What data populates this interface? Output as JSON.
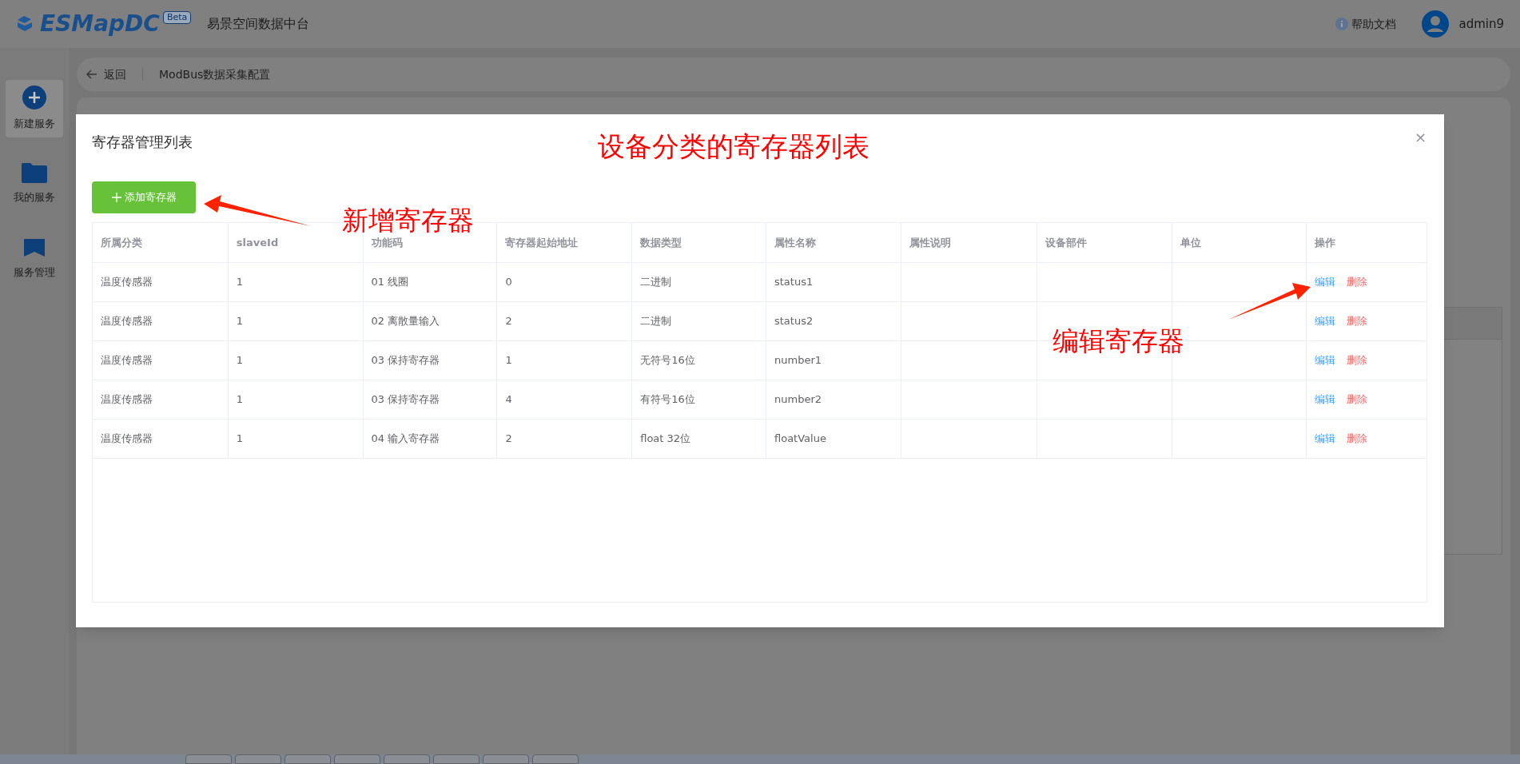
{
  "header": {
    "logo_text": "ESMapDC",
    "logo_badge": "Beta",
    "app_title": "易景空间数据中台",
    "help": "帮助文档",
    "user": "admin9"
  },
  "sidebar": {
    "items": [
      {
        "label": "新建服务",
        "kind": "plus",
        "selected": true
      },
      {
        "label": "我的服务",
        "kind": "folder",
        "selected": false
      },
      {
        "label": "服务管理",
        "kind": "bookmark",
        "selected": false
      }
    ]
  },
  "breadcrumb": {
    "back": "返回",
    "title": "ModBus数据采集配置"
  },
  "modal": {
    "title": "寄存器管理列表",
    "close": "×",
    "add_button": "添加寄存器",
    "table": {
      "columns": [
        "所属分类",
        "slaveId",
        "功能码",
        "寄存器起始地址",
        "数据类型",
        "属性名称",
        "属性说明",
        "设备部件",
        "单位",
        "操作"
      ],
      "rows": [
        {
          "category": "温度传感器",
          "slave_id": "1",
          "function_code": "01 线圈",
          "start_address": "0",
          "data_type": "二进制",
          "attribute_name": "status1",
          "actions": [
            "编辑",
            "删除"
          ]
        },
        {
          "category": "温度传感器",
          "slave_id": "1",
          "function_code": "02 离散量输入",
          "start_address": "2",
          "data_type": "二进制",
          "attribute_name": "status2",
          "actions": [
            "编辑",
            "删除"
          ]
        },
        {
          "category": "温度传感器",
          "slave_id": "1",
          "function_code": "03 保持寄存器",
          "start_address": "1",
          "data_type": "无符号16位",
          "attribute_name": "number1",
          "actions": [
            "编辑",
            "删除"
          ]
        },
        {
          "category": "温度传感器",
          "slave_id": "1",
          "function_code": "03 保持寄存器",
          "start_address": "4",
          "data_type": "有符号16位",
          "attribute_name": "number2",
          "actions": [
            "编辑",
            "删除"
          ]
        },
        {
          "category": "温度传感器",
          "slave_id": "1",
          "function_code": "04 输入寄存器",
          "start_address": "2",
          "data_type": "float 32位",
          "attribute_name": "floatValue",
          "actions": [
            "编辑",
            "删除"
          ]
        }
      ]
    }
  },
  "annotations": [
    {
      "text": "设备分类的寄存器列表",
      "kind": "heading"
    },
    {
      "text": "新增寄存器",
      "kind": "label"
    },
    {
      "text": "编辑寄存器",
      "kind": "label"
    }
  ]
}
